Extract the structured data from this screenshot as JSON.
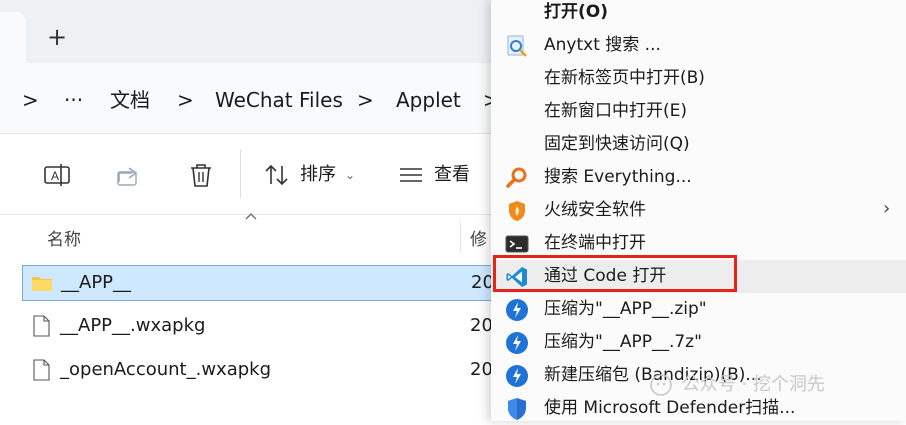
{
  "tabstrip": {
    "new_tab_label": "+"
  },
  "breadcrumb": {
    "items": [
      "文档",
      "WeChat Files",
      "Applet"
    ],
    "more": "···",
    "separator": ">"
  },
  "toolbar": {
    "sort_label": "排序",
    "view_label": "查看"
  },
  "columns": {
    "name": "名称",
    "date": "修"
  },
  "files": [
    {
      "name": "__APP__",
      "date": "20",
      "type": "folder",
      "selected": true
    },
    {
      "name": "__APP__.wxapkg",
      "date": "20",
      "type": "file",
      "selected": false
    },
    {
      "name": "_openAccount_.wxapkg",
      "date": "20",
      "type": "file",
      "selected": false
    }
  ],
  "context_menu": {
    "items": [
      {
        "label": "打开(O)",
        "icon": "none",
        "bold": true
      },
      {
        "label": "Anytxt 搜索 ...",
        "icon": "anytxt-icon"
      },
      {
        "label": "在新标签页中打开(B)",
        "icon": "none"
      },
      {
        "label": "在新窗口中打开(E)",
        "icon": "none"
      },
      {
        "label": "固定到快速访问(Q)",
        "icon": "none"
      },
      {
        "label": "搜索 Everything...",
        "icon": "everything-search-icon"
      },
      {
        "label": "火绒安全软件",
        "icon": "huorong-icon",
        "submenu": true
      },
      {
        "label": "在终端中打开",
        "icon": "terminal-icon"
      },
      {
        "label": "通过 Code 打开",
        "icon": "vscode-icon",
        "highlighted": true
      },
      {
        "label": "压缩为\"__APP__.zip\"",
        "icon": "bandizip-icon"
      },
      {
        "label": "压缩为\"__APP__.7z\"",
        "icon": "bandizip-icon"
      },
      {
        "label": "新建压缩包 (Bandizip)(B)...",
        "icon": "bandizip-icon"
      },
      {
        "label": "使用 Microsoft Defender扫描...",
        "icon": "defender-icon"
      }
    ]
  },
  "watermark": {
    "text": "公众号 · 挖个洞先"
  },
  "colors": {
    "selection": "#cde8ff",
    "highlight_box": "#e8231a",
    "vscode_blue": "#1f8ad2"
  }
}
